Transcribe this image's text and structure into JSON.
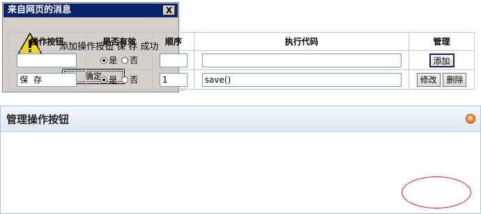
{
  "alert": {
    "title": "来自网页的消息",
    "close_label": "X",
    "message": "添加操作按钮 保 存 成功",
    "ok_label": "确定"
  },
  "panel": {
    "title": "管理操作按钮",
    "close_label": "×"
  },
  "table": {
    "headers": [
      "操作按钮",
      "是否有效",
      "顺序",
      "执行代码",
      "管理"
    ],
    "radio_yes": "是",
    "radio_no": "否",
    "new_row": {
      "name": "",
      "order": "",
      "code": "",
      "add_label": "添加"
    },
    "row1": {
      "name": "保  存",
      "order": "1",
      "code": "save()",
      "edit_label": "修改",
      "delete_label": "删除"
    }
  },
  "colors": {
    "highlight": "#e01010",
    "title_bar": "#0a246a"
  }
}
